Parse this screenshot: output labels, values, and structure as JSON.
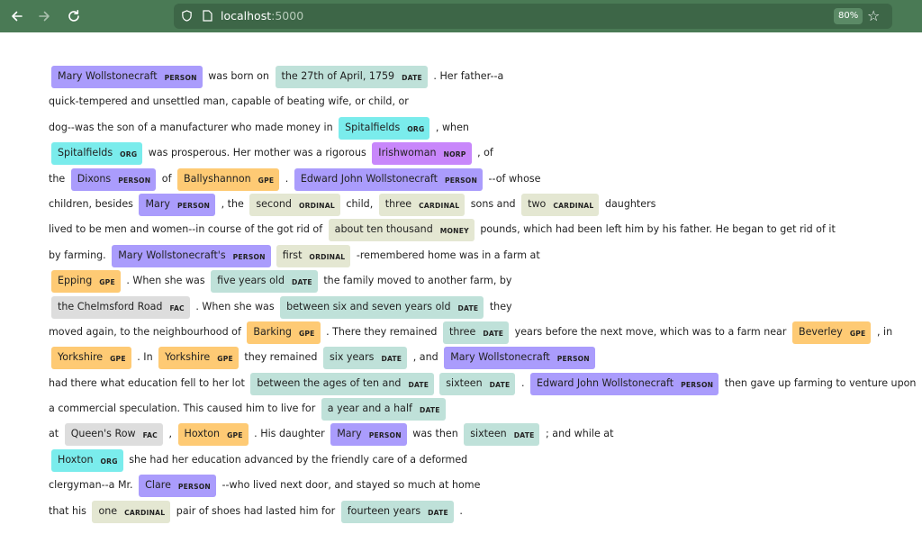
{
  "browser": {
    "back_icon": "arrow-left-icon",
    "forward_icon": "arrow-right-icon",
    "reload_icon": "reload-icon",
    "url_host": "localhost",
    "url_port": ":5000",
    "zoom": "80%",
    "bookmark_icon": "star-icon"
  },
  "colors": {
    "chrome": "#4a7a55",
    "PERSON": "#aa9cfc",
    "DATE": "#bfe1d9",
    "ORG": "#7aecec",
    "NORP": "#c887fb",
    "GPE": "#feca74",
    "ORDINAL": "#e4e7d2",
    "CARDINAL": "#e4e7d2",
    "MONEY": "#e4e7d2",
    "FAC": "#dddddd"
  },
  "lines": [
    [
      {
        "e": "Mary Wollstonecraft",
        "l": "PERSON"
      },
      {
        "t": "was born on"
      },
      {
        "e": "the 27th of April, 1759",
        "l": "DATE"
      },
      {
        "t": ". Her father--a"
      }
    ],
    [
      {
        "t": "quick-tempered and unsettled man, capable of beating wife, or child, or"
      }
    ],
    [
      {
        "t": "dog--was the son of a manufacturer who made money in"
      },
      {
        "e": "Spitalfields",
        "l": "ORG"
      },
      {
        "t": ", when"
      }
    ],
    [
      {
        "e": "Spitalfields",
        "l": "ORG"
      },
      {
        "t": "was prosperous. Her mother was a rigorous"
      },
      {
        "e": "Irishwoman",
        "l": "NORP"
      },
      {
        "t": ", of"
      }
    ],
    [
      {
        "t": "the"
      },
      {
        "e": "Dixons",
        "l": "PERSON"
      },
      {
        "t": "of"
      },
      {
        "e": "Ballyshannon",
        "l": "GPE"
      },
      {
        "t": "."
      },
      {
        "e": "Edward John Wollstonecraft",
        "l": "PERSON"
      },
      {
        "t": "--of whose"
      }
    ],
    [
      {
        "t": "children, besides"
      },
      {
        "e": "Mary",
        "l": "PERSON"
      },
      {
        "t": ", the"
      },
      {
        "e": "second",
        "l": "ORDINAL"
      },
      {
        "t": "child,"
      },
      {
        "e": "three",
        "l": "CARDINAL"
      },
      {
        "t": "sons and"
      },
      {
        "e": "two",
        "l": "CARDINAL"
      },
      {
        "t": "daughters"
      }
    ],
    [
      {
        "t": "lived to be men and women--in course of the got rid of"
      },
      {
        "e": "about ten thousand",
        "l": "MONEY"
      },
      {
        "t": "pounds, which had been left him by his father. He began to get rid of it"
      }
    ],
    [
      {
        "t": "by farming."
      },
      {
        "e": "Mary Wollstonecraft's",
        "l": "PERSON"
      },
      {
        "e": "first",
        "l": "ORDINAL"
      },
      {
        "t": "-remembered home was in a farm at"
      }
    ],
    [
      {
        "e": "Epping",
        "l": "GPE"
      },
      {
        "t": ". When she was"
      },
      {
        "e": "five years old",
        "l": "DATE"
      },
      {
        "t": "the family moved to another farm, by"
      }
    ],
    [
      {
        "e": "the Chelmsford Road",
        "l": "FAC"
      },
      {
        "t": ". When she was"
      },
      {
        "e": "between six and seven years old",
        "l": "DATE"
      },
      {
        "t": "they"
      }
    ],
    [
      {
        "t": "moved again, to the neighbourhood of"
      },
      {
        "e": "Barking",
        "l": "GPE"
      },
      {
        "t": ". There they remained"
      },
      {
        "e": "three",
        "l": "DATE"
      },
      {
        "t": "years before the next move, which was to a farm near"
      },
      {
        "e": "Beverley",
        "l": "GPE"
      },
      {
        "t": ", in"
      }
    ],
    [
      {
        "e": "Yorkshire",
        "l": "GPE"
      },
      {
        "t": ". In"
      },
      {
        "e": "Yorkshire",
        "l": "GPE"
      },
      {
        "t": "they remained"
      },
      {
        "e": "six years",
        "l": "DATE"
      },
      {
        "t": ", and"
      },
      {
        "e": "Mary Wollstonecraft",
        "l": "PERSON"
      }
    ],
    [
      {
        "t": "had there what education fell to her lot"
      },
      {
        "e": "between the ages of ten and",
        "l": "DATE"
      },
      {
        "e": "sixteen",
        "l": "DATE"
      },
      {
        "t": "."
      },
      {
        "e": "Edward John Wollstonecraft",
        "l": "PERSON"
      },
      {
        "t": "then gave up farming to venture upon"
      }
    ],
    [
      {
        "t": "a commercial speculation. This caused him to live for"
      },
      {
        "e": "a year and a half",
        "l": "DATE"
      }
    ],
    [
      {
        "t": "at"
      },
      {
        "e": "Queen's Row",
        "l": "FAC"
      },
      {
        "t": ","
      },
      {
        "e": "Hoxton",
        "l": "GPE"
      },
      {
        "t": ". His daughter"
      },
      {
        "e": "Mary",
        "l": "PERSON"
      },
      {
        "t": "was then"
      },
      {
        "e": "sixteen",
        "l": "DATE"
      },
      {
        "t": "; and while at"
      }
    ],
    [
      {
        "e": "Hoxton",
        "l": "ORG"
      },
      {
        "t": "she had her education advanced by the friendly care of a deformed"
      }
    ],
    [
      {
        "t": "clergyman--a Mr."
      },
      {
        "e": "Clare",
        "l": "PERSON"
      },
      {
        "t": "--who lived next door, and stayed so much at home"
      }
    ],
    [
      {
        "t": "that his"
      },
      {
        "e": "one",
        "l": "CARDINAL"
      },
      {
        "t": "pair of shoes had lasted him for"
      },
      {
        "e": "fourteen years",
        "l": "DATE"
      },
      {
        "t": "."
      }
    ]
  ]
}
